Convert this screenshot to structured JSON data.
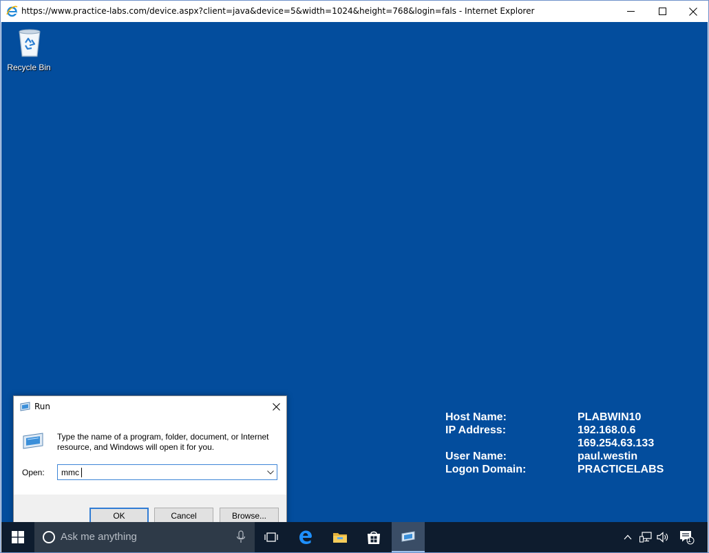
{
  "window": {
    "title": "https://www.practice-labs.com/device.aspx?client=java&device=5&width=1024&height=768&login=fals - Internet Explorer",
    "controls": {
      "minimize_icon": "minimize-icon",
      "maximize_icon": "maximize-icon",
      "close_icon": "close-icon"
    }
  },
  "desktop": {
    "background": "#034d9d",
    "icons": [
      {
        "label": "Recycle Bin",
        "icon": "recycle-bin-icon"
      }
    ]
  },
  "host_info": {
    "rows": [
      {
        "label": "Host Name:",
        "value": "PLABWIN10"
      },
      {
        "label": "IP Address:",
        "value": "192.168.0.6"
      },
      {
        "label": "",
        "value": "169.254.63.133"
      },
      {
        "label": "User Name:",
        "value": "paul.westin"
      },
      {
        "label": "Logon Domain:",
        "value": "PRACTICELABS"
      }
    ]
  },
  "run_dialog": {
    "title": "Run",
    "description": "Type the name of a program, folder, document, or Internet resource, and Windows will open it for you.",
    "open_label": "Open:",
    "open_value": "mmc",
    "buttons": {
      "ok": "OK",
      "cancel": "Cancel",
      "browse": "Browse..."
    }
  },
  "taskbar": {
    "search_placeholder": "Ask me anything",
    "pinned": [
      "task-view-icon",
      "edge-icon",
      "file-explorer-icon",
      "store-icon",
      "run-icon"
    ],
    "tray": [
      "chevron-up-icon",
      "network-icon",
      "volume-icon",
      "notifications-icon"
    ],
    "notification_count": "1",
    "colors": {
      "taskbar": "#0e1c2e",
      "search_box": "#2e3a48",
      "accent": "#2f7bd4"
    }
  }
}
